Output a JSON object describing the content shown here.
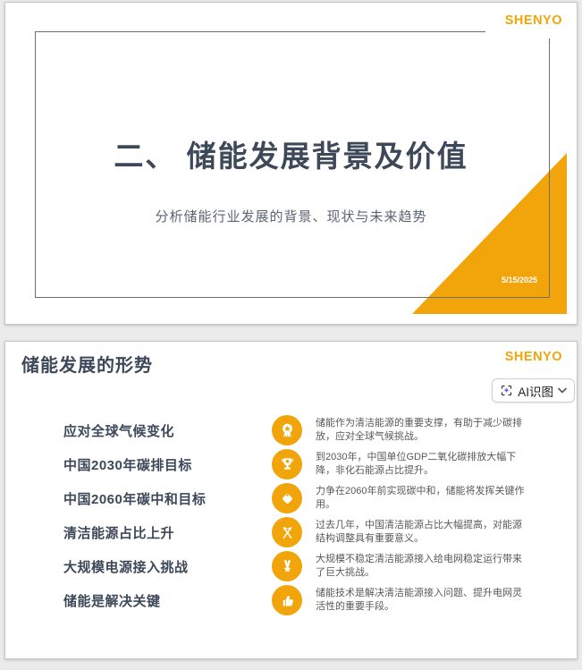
{
  "colors": {
    "accent": "#F2A50A",
    "heading": "#3D4859",
    "body": "#595959",
    "ai_icon_purple": "#7B5BE8"
  },
  "slide1": {
    "logo": "SHENYO",
    "title": "二、 储能发展背景及价值",
    "subtitle": "分析储能行业发展的背景、现状与未来趋势",
    "date": "5/15/2025"
  },
  "slide2": {
    "logo": "SHENYO",
    "title": "储能发展的形势",
    "ai_button": {
      "label": "AI识图",
      "icon": "ai-scan-sparkle",
      "chevron": "chevron-down"
    },
    "items": [
      {
        "icon": "award-rosette",
        "label": "应对全球气候变化",
        "desc": "储能作为清洁能源的重要支撑，有助于减少碳排放，应对全球气候挑战。"
      },
      {
        "icon": "trophy",
        "label": "中国2030年碳排目标",
        "desc": "到2030年，中国单位GDP二氧化碳排放大幅下降，非化石能源占比提升。"
      },
      {
        "icon": "tag",
        "label": "中国2060年碳中和目标",
        "desc": "力争在2060年前实现碳中和，储能将发挥关键作用。"
      },
      {
        "icon": "crossed-flags",
        "label": "清洁能源占比上升",
        "desc": "过去几年，中国清洁能源占比大幅提高，对能源结构调整具有重要意义。"
      },
      {
        "icon": "medal-star",
        "label": "大规模电源接入挑战",
        "desc": "大规模不稳定清洁能源接入给电网稳定运行带来了巨大挑战。"
      },
      {
        "icon": "thumbs-up",
        "label": "储能是解决关键",
        "desc": "储能技术是解决清洁能源接入问题、提升电网灵活性的重要手段。"
      }
    ]
  }
}
